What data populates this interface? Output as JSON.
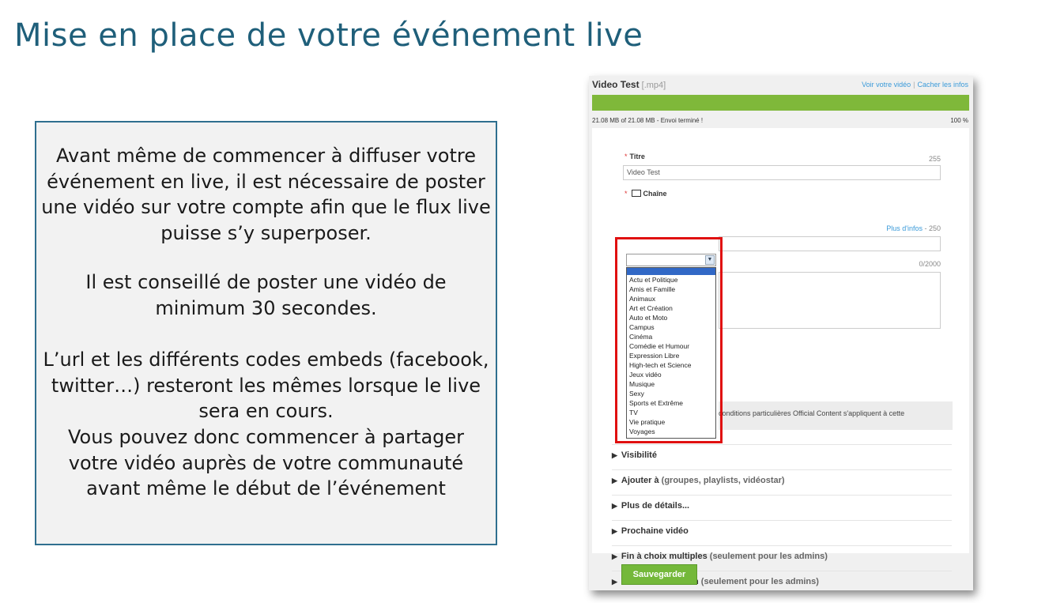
{
  "slide": {
    "title": "Mise en place de votre événement live",
    "paragraphs": [
      "Avant même de commencer à diffuser votre événement en live, il est nécessaire de poster une vidéo sur votre compte afin que le flux live puisse s’y superposer.",
      "Il est conseillé de poster une vidéo de minimum 30 secondes.",
      "L’url et les différents codes embeds (facebook, twitter…) resteront les mêmes lorsque le live sera en cours.",
      "Vous pouvez donc commencer à partager votre vidéo auprès de votre communauté avant même le début de l’événement"
    ]
  },
  "upload": {
    "video_name": "Video Test",
    "video_ext": "[.mp4]",
    "link_view": "Voir votre vidéo",
    "link_hide": "Cacher les infos",
    "progress_fraction": 1.0,
    "status": "21.08 MB of 21.08 MB - Envoi terminé !",
    "percent": "100 %"
  },
  "form": {
    "required_mark": "*",
    "title_label": "Titre",
    "title_counter": "255",
    "title_value": "Video Test",
    "channel_label": "Chaîne",
    "channel_selected": "",
    "tags_more": "Plus d'infos",
    "tags_counter_sep": " - ",
    "tags_counter": "250",
    "description_counter": "0/2000",
    "notice_text": "conditions particulières Official Content s'appliquent à cette",
    "channel_options": [
      "Actu et Politique",
      "Amis et Famille",
      "Animaux",
      "Art et Création",
      "Auto et Moto",
      "Campus",
      "Cinéma",
      "Comédie et Humour",
      "Expression Libre",
      "High-tech et Science",
      "Jeux vidéo",
      "Musique",
      "Sexy",
      "Sports et Extrême",
      "TV",
      "Vie pratique",
      "Voyages"
    ],
    "sections": [
      {
        "label": "Visibilité",
        "extra": ""
      },
      {
        "label": "Ajouter à",
        "extra": " (groupes, playlists, vidéostar)"
      },
      {
        "label": "Plus de détails...",
        "extra": ""
      },
      {
        "label": "Prochaine vidéo",
        "extra": ""
      },
      {
        "label": "Fin à choix multiples",
        "extra": " (seulement pour les admins)"
      },
      {
        "label": "Personnalise ta fin",
        "extra": " (seulement pour les admins)"
      }
    ],
    "save_label": "Sauvegarder"
  },
  "colors": {
    "title": "#1f5f7a",
    "box_border": "#2f6f8f",
    "progress": "#7fb83a",
    "highlight": "#e01010",
    "link": "#3a9ad9",
    "button": "#74b83a"
  }
}
